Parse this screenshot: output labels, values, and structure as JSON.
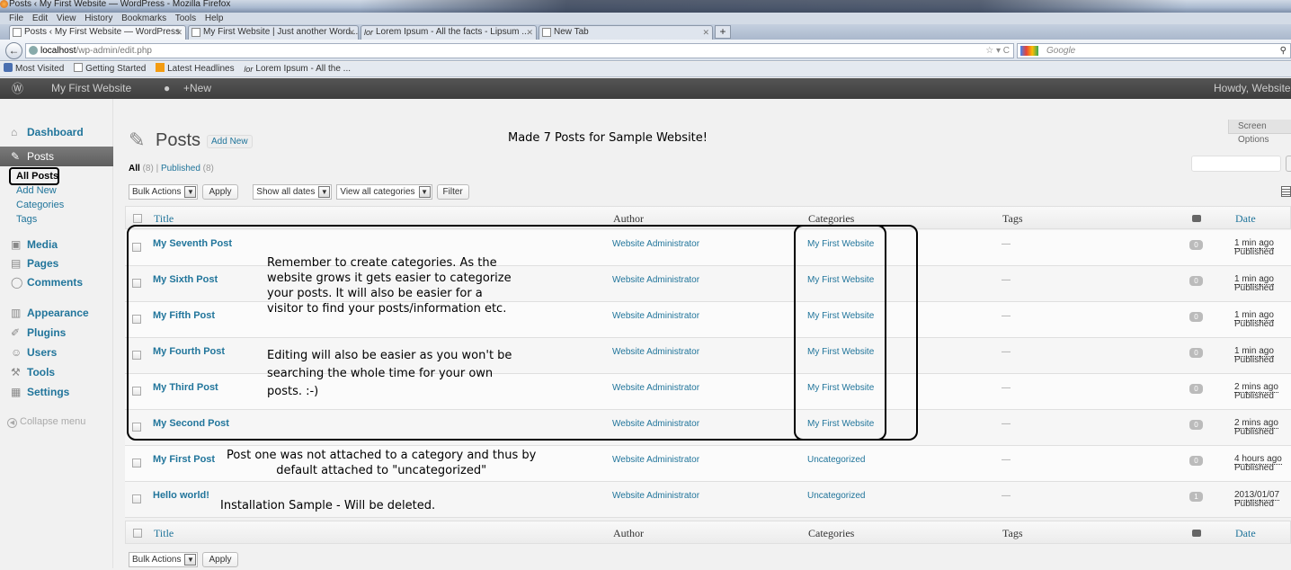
{
  "browser": {
    "window_title": "Posts ‹ My First Website — WordPress - Mozilla Firefox",
    "menu": [
      "File",
      "Edit",
      "View",
      "History",
      "Bookmarks",
      "Tools",
      "Help"
    ],
    "tabs": [
      {
        "label": "Posts ‹ My First Website — WordPress"
      },
      {
        "label": "My First Website | Just another Word..."
      },
      {
        "label": "Lorem Ipsum - All the facts - Lipsum ..."
      },
      {
        "label": "New Tab"
      }
    ],
    "url_host": "localhost",
    "url_path": "/wp-admin/edit.php",
    "search_placeholder": "Google",
    "bookmarks": [
      "Most Visited",
      "Getting Started",
      "Latest Headlines",
      "Lorem Ipsum - All the ..."
    ]
  },
  "adminbar": {
    "site_name": "My First Website",
    "new_label": "New",
    "howdy": "Howdy, Website Ad"
  },
  "sidebar": {
    "items": [
      {
        "label": "Dashboard",
        "icon": "house-icon"
      },
      {
        "label": "Posts",
        "icon": "pushpin-icon"
      },
      {
        "label": "Media",
        "icon": "media-icon"
      },
      {
        "label": "Pages",
        "icon": "pages-icon"
      },
      {
        "label": "Comments",
        "icon": "comment-icon"
      },
      {
        "label": "Appearance",
        "icon": "appearance-icon"
      },
      {
        "label": "Plugins",
        "icon": "plugin-icon"
      },
      {
        "label": "Users",
        "icon": "users-icon"
      },
      {
        "label": "Tools",
        "icon": "tools-icon"
      },
      {
        "label": "Settings",
        "icon": "settings-icon"
      }
    ],
    "posts_submenu": [
      "All Posts",
      "Add New",
      "Categories",
      "Tags"
    ],
    "collapse_label": "Collapse menu"
  },
  "main": {
    "title": "Posts",
    "add_new": "Add New",
    "screen_options": "Screen Options",
    "filters": {
      "all_label": "All",
      "all_count": "(8)",
      "published_label": "Published",
      "published_count": "(8)"
    },
    "tablenav": {
      "bulk_actions": "Bulk Actions",
      "apply": "Apply",
      "dates": "Show all dates",
      "categories": "View all categories",
      "filter": "Filter"
    },
    "columns": {
      "title": "Title",
      "author": "Author",
      "categories": "Categories",
      "tags": "Tags",
      "date": "Date"
    },
    "rows": [
      {
        "title": "My Seventh Post",
        "author": "Website Administrator",
        "category": "My First Website",
        "tags": "—",
        "comments": "0",
        "date": "1 min ago",
        "status": "Published"
      },
      {
        "title": "My Sixth Post",
        "author": "Website Administrator",
        "category": "My First Website",
        "tags": "—",
        "comments": "0",
        "date": "1 min ago",
        "status": "Published"
      },
      {
        "title": "My Fifth Post",
        "author": "Website Administrator",
        "category": "My First Website",
        "tags": "—",
        "comments": "0",
        "date": "1 min ago",
        "status": "Published"
      },
      {
        "title": "My Fourth Post",
        "author": "Website Administrator",
        "category": "My First Website",
        "tags": "—",
        "comments": "0",
        "date": "1 min ago",
        "status": "Published"
      },
      {
        "title": "My Third Post",
        "author": "Website Administrator",
        "category": "My First Website",
        "tags": "—",
        "comments": "0",
        "date": "2 mins ago",
        "status": "Published"
      },
      {
        "title": "My Second Post",
        "author": "Website Administrator",
        "category": "My First Website",
        "tags": "—",
        "comments": "0",
        "date": "2 mins ago",
        "status": "Published"
      },
      {
        "title": "My First Post",
        "author": "Website Administrator",
        "category": "Uncategorized",
        "tags": "—",
        "comments": "0",
        "date": "4 hours ago",
        "status": "Published"
      },
      {
        "title": "Hello world!",
        "author": "Website Administrator",
        "category": "Uncategorized",
        "tags": "—",
        "comments": "1",
        "date": "2013/01/07",
        "status": "Published"
      }
    ]
  },
  "annotations": {
    "header_note": "Made 7 Posts for Sample Website!",
    "categories_note": [
      "Remember to create categories. As the",
      "website grows it gets easier to categorize",
      "your posts. It will also be easier for a",
      "visitor to find your posts/information etc."
    ],
    "editing_note": [
      "Editing will also be easier as you won't be",
      "searching the whole time for your own",
      "posts. :-)"
    ],
    "first_post_note": [
      "Post one was not attached to a category and thus by",
      "default attached to \"uncategorized\""
    ],
    "hello_note": "Installation Sample - Will be deleted."
  },
  "colors": {
    "link": "#21759b",
    "adminbar": "#464646",
    "menu_current": "#6d6d6d"
  }
}
